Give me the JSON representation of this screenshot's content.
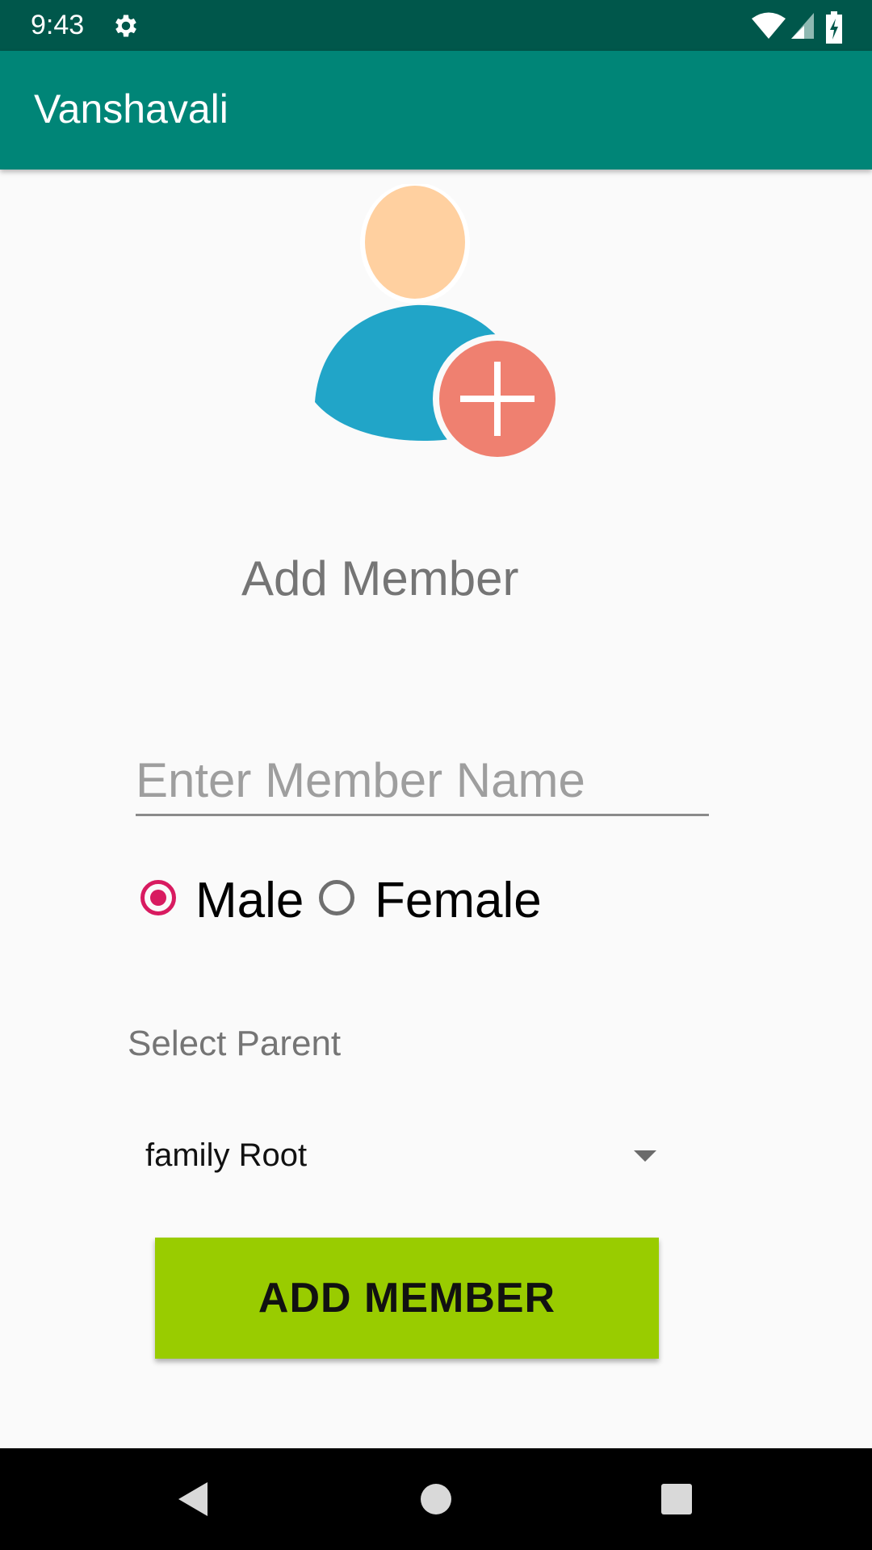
{
  "status_bar": {
    "time": "9:43",
    "icons": [
      "settings-gear-icon",
      "wifi-icon",
      "signal-icon",
      "battery-charging-icon"
    ]
  },
  "app_bar": {
    "title": "Vanshavali"
  },
  "avatar": {
    "icon": "add-user-icon",
    "colors": {
      "head": "#ffd0a0",
      "body": "#21a5c8",
      "plus_badge": "#ef8070"
    }
  },
  "form": {
    "heading": "Add Member",
    "name_input": {
      "placeholder": "Enter Member Name",
      "value": ""
    },
    "gender": {
      "options": [
        {
          "label": "Male",
          "checked": true
        },
        {
          "label": "Female",
          "checked": false
        }
      ]
    },
    "parent": {
      "label": "Select Parent",
      "selected": "family Root"
    },
    "submit_label": "ADD MEMBER"
  },
  "colors": {
    "status_bar": "#00574b",
    "app_bar": "#008577",
    "accent": "#d81b60",
    "button": "#99cc00"
  },
  "nav_bar": {
    "buttons": [
      "back-icon",
      "home-icon",
      "recents-icon"
    ]
  }
}
